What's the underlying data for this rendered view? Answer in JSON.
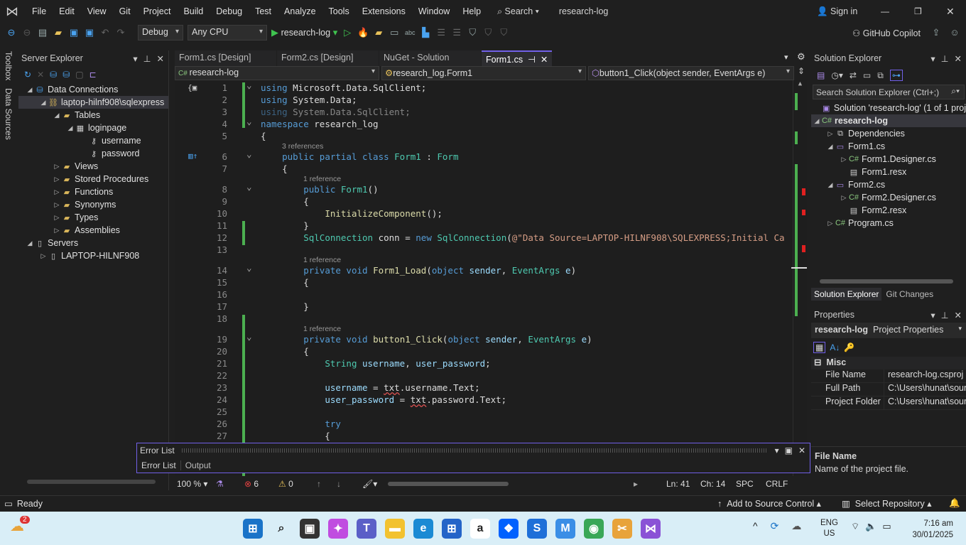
{
  "menu": [
    "File",
    "Edit",
    "View",
    "Git",
    "Project",
    "Build",
    "Debug",
    "Test",
    "Analyze",
    "Tools",
    "Extensions",
    "Window",
    "Help"
  ],
  "search_label": "Search",
  "solution_name": "research-log",
  "sign_in": "Sign in",
  "toolbar": {
    "config": "Debug",
    "platform": "Any CPU",
    "run_target": "research-log",
    "copilot": "GitHub Copilot"
  },
  "server_explorer": {
    "title": "Server Explorer",
    "items": [
      {
        "label": "Data Connections",
        "depth": 0,
        "tw": "◢",
        "icon": "database-icon"
      },
      {
        "label": "laptop-hilnf908\\sqlexpress",
        "depth": 1,
        "tw": "◢",
        "icon": "connection-icon",
        "selected": true
      },
      {
        "label": "Tables",
        "depth": 2,
        "tw": "◢",
        "icon": "folder-icon"
      },
      {
        "label": "loginpage",
        "depth": 3,
        "tw": "◢",
        "icon": "table-icon"
      },
      {
        "label": "username",
        "depth": 4,
        "tw": "",
        "icon": "column-key-icon"
      },
      {
        "label": "password",
        "depth": 4,
        "tw": "",
        "icon": "column-key-icon"
      },
      {
        "label": "Views",
        "depth": 2,
        "tw": "▷",
        "icon": "folder-icon"
      },
      {
        "label": "Stored Procedures",
        "depth": 2,
        "tw": "▷",
        "icon": "folder-icon"
      },
      {
        "label": "Functions",
        "depth": 2,
        "tw": "▷",
        "icon": "folder-icon"
      },
      {
        "label": "Synonyms",
        "depth": 2,
        "tw": "▷",
        "icon": "folder-icon"
      },
      {
        "label": "Types",
        "depth": 2,
        "tw": "▷",
        "icon": "folder-icon"
      },
      {
        "label": "Assemblies",
        "depth": 2,
        "tw": "▷",
        "icon": "folder-icon"
      },
      {
        "label": "Servers",
        "depth": 0,
        "tw": "◢",
        "icon": "server-icon"
      },
      {
        "label": "LAPTOP-HILNF908",
        "depth": 1,
        "tw": "▷",
        "icon": "server-icon"
      }
    ]
  },
  "side_tabs": [
    "Toolbox",
    "Data Sources"
  ],
  "tabs": [
    {
      "label": "Form1.cs [Design]"
    },
    {
      "label": "Form2.cs [Design]"
    },
    {
      "label": "NuGet - Solution"
    },
    {
      "label": "Form1.cs",
      "active": true
    }
  ],
  "nav": {
    "project": "research-log",
    "type": "research_log.Form1",
    "member": "button1_Click(object sender, EventArgs e)"
  },
  "code": [
    {
      "n": "1",
      "t": [
        [
          "kw",
          "using "
        ],
        [
          "id",
          "Microsoft.Data.SqlClient;"
        ]
      ]
    },
    {
      "n": "2",
      "t": [
        [
          "kw",
          "using "
        ],
        [
          "id",
          "System.Data;"
        ]
      ]
    },
    {
      "n": "3",
      "t": [
        [
          "kw dim",
          "using "
        ],
        [
          "id dim",
          "System.Data.SqlClient;"
        ]
      ]
    },
    {
      "n": "4",
      "t": [
        [
          "kw",
          "namespace "
        ],
        [
          "id",
          "research_log"
        ]
      ]
    },
    {
      "n": "5",
      "t": [
        [
          "id",
          "{"
        ]
      ]
    },
    {
      "lens": "3 references",
      "i": 4
    },
    {
      "n": "6",
      "t": [
        [
          "id",
          "    "
        ],
        [
          "kw",
          "public partial class "
        ],
        [
          "ty",
          "Form1"
        ],
        [
          "id",
          " : "
        ],
        [
          "ty",
          "Form"
        ]
      ]
    },
    {
      "n": "7",
      "t": [
        [
          "id",
          "    {"
        ]
      ]
    },
    {
      "lens": "1 reference",
      "i": 8
    },
    {
      "n": "8",
      "t": [
        [
          "id",
          "        "
        ],
        [
          "kw",
          "public "
        ],
        [
          "ty",
          "Form1"
        ],
        [
          "id",
          "()"
        ]
      ]
    },
    {
      "n": "9",
      "t": [
        [
          "id",
          "        {"
        ]
      ]
    },
    {
      "n": "10",
      "t": [
        [
          "id",
          "            "
        ],
        [
          "fn",
          "InitializeComponent"
        ],
        [
          "id",
          "();"
        ]
      ]
    },
    {
      "n": "11",
      "t": [
        [
          "id",
          "        }"
        ]
      ]
    },
    {
      "n": "12",
      "t": [
        [
          "id",
          "        "
        ],
        [
          "ty",
          "SqlConnection"
        ],
        [
          "id",
          " conn = "
        ],
        [
          "kw",
          "new "
        ],
        [
          "ty",
          "SqlConnection"
        ],
        [
          "id",
          "("
        ],
        [
          "st",
          "@\"Data Source=LAPTOP-HILNF908\\SQLEXPRESS;Initial Ca"
        ]
      ]
    },
    {
      "n": "13",
      "t": []
    },
    {
      "lens": "1 reference",
      "i": 8
    },
    {
      "n": "14",
      "t": [
        [
          "id",
          "        "
        ],
        [
          "kw",
          "private void "
        ],
        [
          "fn",
          "Form1_Load"
        ],
        [
          "id",
          "("
        ],
        [
          "kw",
          "object "
        ],
        [
          "vr",
          "sender"
        ],
        [
          "id",
          ", "
        ],
        [
          "ty",
          "EventArgs "
        ],
        [
          "vr",
          "e"
        ],
        [
          "id",
          ")"
        ]
      ]
    },
    {
      "n": "15",
      "t": [
        [
          "id",
          "        {"
        ]
      ]
    },
    {
      "n": "16",
      "t": []
    },
    {
      "n": "17",
      "t": [
        [
          "id",
          "        }"
        ]
      ]
    },
    {
      "n": "18",
      "t": []
    },
    {
      "lens": "1 reference",
      "i": 8
    },
    {
      "n": "19",
      "t": [
        [
          "id",
          "        "
        ],
        [
          "kw",
          "private void "
        ],
        [
          "fn",
          "button1_Click"
        ],
        [
          "id",
          "("
        ],
        [
          "kw",
          "object "
        ],
        [
          "vr",
          "sender"
        ],
        [
          "id",
          ", "
        ],
        [
          "ty",
          "EventArgs "
        ],
        [
          "vr",
          "e"
        ],
        [
          "id",
          ")"
        ]
      ]
    },
    {
      "n": "20",
      "t": [
        [
          "id",
          "        {"
        ]
      ]
    },
    {
      "n": "21",
      "t": [
        [
          "id",
          "            "
        ],
        [
          "ty",
          "String "
        ],
        [
          "vr",
          "username"
        ],
        [
          "id",
          ", "
        ],
        [
          "vr",
          "user_password"
        ],
        [
          "id",
          ";"
        ]
      ]
    },
    {
      "n": "22",
      "t": []
    },
    {
      "n": "23",
      "t": [
        [
          "id",
          "            "
        ],
        [
          "vr",
          "username"
        ],
        [
          "id",
          " = "
        ],
        [
          "id squig",
          "txt"
        ],
        [
          "id",
          ".username.Text;"
        ]
      ]
    },
    {
      "n": "24",
      "t": [
        [
          "id",
          "            "
        ],
        [
          "vr",
          "user_password"
        ],
        [
          "id",
          " = "
        ],
        [
          "id squig",
          "txt"
        ],
        [
          "id",
          ".password.Text;"
        ]
      ]
    },
    {
      "n": "25",
      "t": []
    },
    {
      "n": "26",
      "t": [
        [
          "id",
          "            "
        ],
        [
          "kw",
          "try"
        ]
      ]
    },
    {
      "n": "27",
      "t": [
        [
          "id",
          "            {"
        ]
      ]
    }
  ],
  "editor_status": {
    "zoom": "100 %",
    "errors": "6",
    "warnings": "0",
    "line": "Ln: 41",
    "col": "Ch: 14",
    "spc": "SPC",
    "eol": "CRLF"
  },
  "error_list": {
    "title": "Error List",
    "tabs": [
      "Error List",
      "Output"
    ]
  },
  "solution_explorer": {
    "title": "Solution Explorer",
    "search_placeholder": "Search Solution Explorer (Ctrl+;)",
    "items": [
      {
        "label": "Solution 'research-log' (1 of 1 proj",
        "depth": 0,
        "tw": "",
        "icon": "solution-icon"
      },
      {
        "label": "research-log",
        "depth": 0,
        "tw": "◢",
        "icon": "csharp-project-icon",
        "selected": true,
        "bold": true
      },
      {
        "label": "Dependencies",
        "depth": 1,
        "tw": "▷",
        "icon": "dependencies-icon"
      },
      {
        "label": "Form1.cs",
        "depth": 1,
        "tw": "◢",
        "icon": "form-icon"
      },
      {
        "label": "Form1.Designer.cs",
        "depth": 2,
        "tw": "▷",
        "icon": "csharp-file-icon"
      },
      {
        "label": "Form1.resx",
        "depth": 2,
        "tw": "",
        "icon": "resx-icon"
      },
      {
        "label": "Form2.cs",
        "depth": 1,
        "tw": "◢",
        "icon": "form-icon"
      },
      {
        "label": "Form2.Designer.cs",
        "depth": 2,
        "tw": "▷",
        "icon": "csharp-file-icon"
      },
      {
        "label": "Form2.resx",
        "depth": 2,
        "tw": "",
        "icon": "resx-icon"
      },
      {
        "label": "Program.cs",
        "depth": 1,
        "tw": "▷",
        "icon": "csharp-file-icon"
      }
    ],
    "tabs": [
      "Solution Explorer",
      "Git Changes"
    ]
  },
  "properties": {
    "title": "Properties",
    "object": "research-log",
    "object_type": "Project Properties",
    "category": "Misc",
    "rows": [
      {
        "k": "File Name",
        "v": "research-log.csproj"
      },
      {
        "k": "Full Path",
        "v": "C:\\Users\\hunat\\sour"
      },
      {
        "k": "Project Folder",
        "v": "C:\\Users\\hunat\\sour"
      }
    ],
    "desc_title": "File Name",
    "desc": "Name of the project file."
  },
  "status": {
    "ready": "Ready",
    "source_control": "Add to Source Control",
    "repo": "Select Repository"
  },
  "taskbar": {
    "weather_badge": "2",
    "lang1": "ENG",
    "lang2": "US",
    "time": "7:16 am",
    "date": "30/01/2025",
    "apps": [
      {
        "n": "start-icon",
        "c": "#1a73c8",
        "g": "⊞"
      },
      {
        "n": "search-icon",
        "c": "transparent",
        "g": "⌕"
      },
      {
        "n": "task-view-icon",
        "c": "#333",
        "g": "▣"
      },
      {
        "n": "copilot-icon",
        "c": "#c04ce0",
        "g": "✦"
      },
      {
        "n": "teams-icon",
        "c": "#5b5fc7",
        "g": "T"
      },
      {
        "n": "file-explorer-icon",
        "c": "#f2c230",
        "g": "▬"
      },
      {
        "n": "edge-icon",
        "c": "#1a8ad4",
        "g": "e"
      },
      {
        "n": "store-icon",
        "c": "#2464c8",
        "g": "⊞"
      },
      {
        "n": "amazon-icon",
        "c": "#fff",
        "g": "a"
      },
      {
        "n": "dropbox-icon",
        "c": "#0061fe",
        "g": "❖"
      },
      {
        "n": "app-s-icon",
        "c": "#1e6fd8",
        "g": "S"
      },
      {
        "n": "m365-icon",
        "c": "#3a8ee6",
        "g": "M"
      },
      {
        "n": "chrome-icon",
        "c": "#3aa757",
        "g": "◉"
      },
      {
        "n": "snipping-icon",
        "c": "#e8a33a",
        "g": "✂"
      },
      {
        "n": "visual-studio-icon",
        "c": "#8a52d6",
        "g": "⋈"
      }
    ]
  }
}
